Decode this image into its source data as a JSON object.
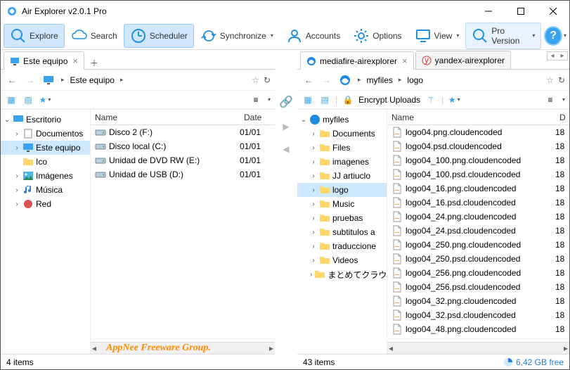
{
  "window": {
    "title": "Air Explorer v2.0.1 Pro"
  },
  "toolbar": {
    "explore": "Explore",
    "search": "Search",
    "scheduler": "Scheduler",
    "synchronize": "Synchronize",
    "accounts": "Accounts",
    "options": "Options",
    "view": "View",
    "pro": "Pro Version"
  },
  "left": {
    "tab": "Este equipo",
    "crumb1": "Este equipo",
    "treeRoot": "Escritorio",
    "tree": {
      "documents": "Documentos",
      "este": "Este equipo",
      "ico": "Ico",
      "imagenes": "Imágenes",
      "musica": "Música",
      "red": "Red"
    },
    "hdr": {
      "name": "Name",
      "date": "Date"
    },
    "rows": [
      {
        "name": "Disco 2 (F:)",
        "date": "01/01"
      },
      {
        "name": "Disco local (C:)",
        "date": "01/01"
      },
      {
        "name": "Unidad de DVD RW (E:)",
        "date": "01/01"
      },
      {
        "name": "Unidad de USB (D:)",
        "date": "01/01"
      }
    ],
    "status": "4 items"
  },
  "right": {
    "tab1": "mediafire-airexplorer",
    "tab2": "yandex-airexplorer",
    "crumb1": "myfiles",
    "crumb2": "logo",
    "encrypt": "Encrypt Uploads",
    "treeRoot": "myfiles",
    "tree": {
      "documents": "Documents",
      "files": "Files",
      "imagenes": "imagenes",
      "jj": "JJ artiuclo",
      "logo": "logo",
      "music": "Music",
      "pruebas": "pruebas",
      "subtitulos": "subtitulos a",
      "traducciones": "traduccione",
      "videos": "Videos",
      "jp": "まとめてクラウ"
    },
    "hdr": {
      "name": "Name",
      "d": "D"
    },
    "rows": [
      {
        "name": "logo04.png.cloudencoded",
        "d": "18"
      },
      {
        "name": "logo04.psd.cloudencoded",
        "d": "18"
      },
      {
        "name": "logo04_100.png.cloudencoded",
        "d": "18"
      },
      {
        "name": "logo04_100.psd.cloudencoded",
        "d": "18"
      },
      {
        "name": "logo04_16.png.cloudencoded",
        "d": "18"
      },
      {
        "name": "logo04_16.psd.cloudencoded",
        "d": "18"
      },
      {
        "name": "logo04_24.png.cloudencoded",
        "d": "18"
      },
      {
        "name": "logo04_24.psd.cloudencoded",
        "d": "18"
      },
      {
        "name": "logo04_250.png.cloudencoded",
        "d": "18"
      },
      {
        "name": "logo04_250.psd.cloudencoded",
        "d": "18"
      },
      {
        "name": "logo04_256.png.cloudencoded",
        "d": "18"
      },
      {
        "name": "logo04_256.psd.cloudencoded",
        "d": "18"
      },
      {
        "name": "logo04_32.png.cloudencoded",
        "d": "18"
      },
      {
        "name": "logo04_32.psd.cloudencoded",
        "d": "18"
      },
      {
        "name": "logo04_48.png.cloudencoded",
        "d": "18"
      }
    ],
    "status": "43 items",
    "free": "6,42 GB free"
  },
  "watermark": "AppNee Freeware Group."
}
